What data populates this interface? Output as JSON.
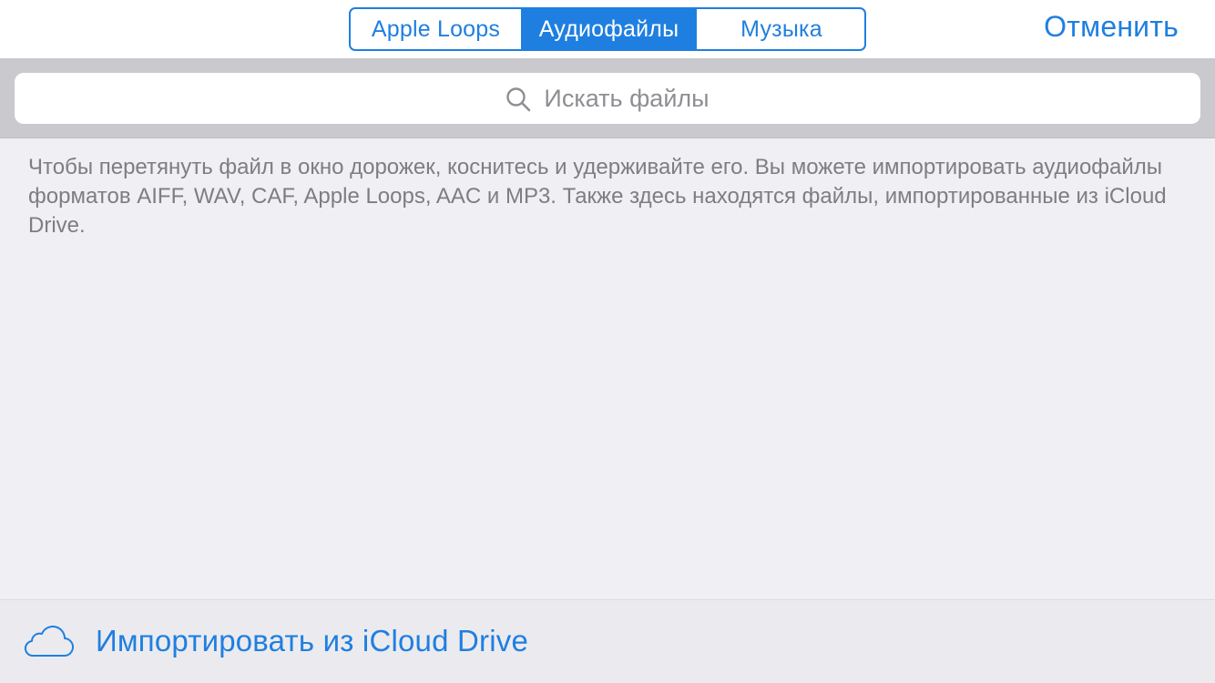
{
  "theme": {
    "accent": "#1f7fe0",
    "background": "#efeff4",
    "search_area_background": "#c9c9ce",
    "secondary_text": "#7d7d82"
  },
  "nav": {
    "segments": [
      {
        "label": "Apple Loops",
        "selected": false
      },
      {
        "label": "Аудиофайлы",
        "selected": true
      },
      {
        "label": "Музыка",
        "selected": false
      }
    ],
    "cancel_label": "Отменить"
  },
  "search": {
    "icon": "search-icon",
    "placeholder": "Искать файлы"
  },
  "info": {
    "text": "Чтобы перетянуть файл в окно дорожек, коснитесь и удерживайте его. Вы можете импортировать аудиофайлы форматов AIFF, WAV, CAF, Apple Loops, AAC и MP3. Также здесь находятся файлы, импортированные из iCloud Drive."
  },
  "footer": {
    "icon": "cloud-icon",
    "import_label": "Импортировать из iCloud Drive"
  }
}
